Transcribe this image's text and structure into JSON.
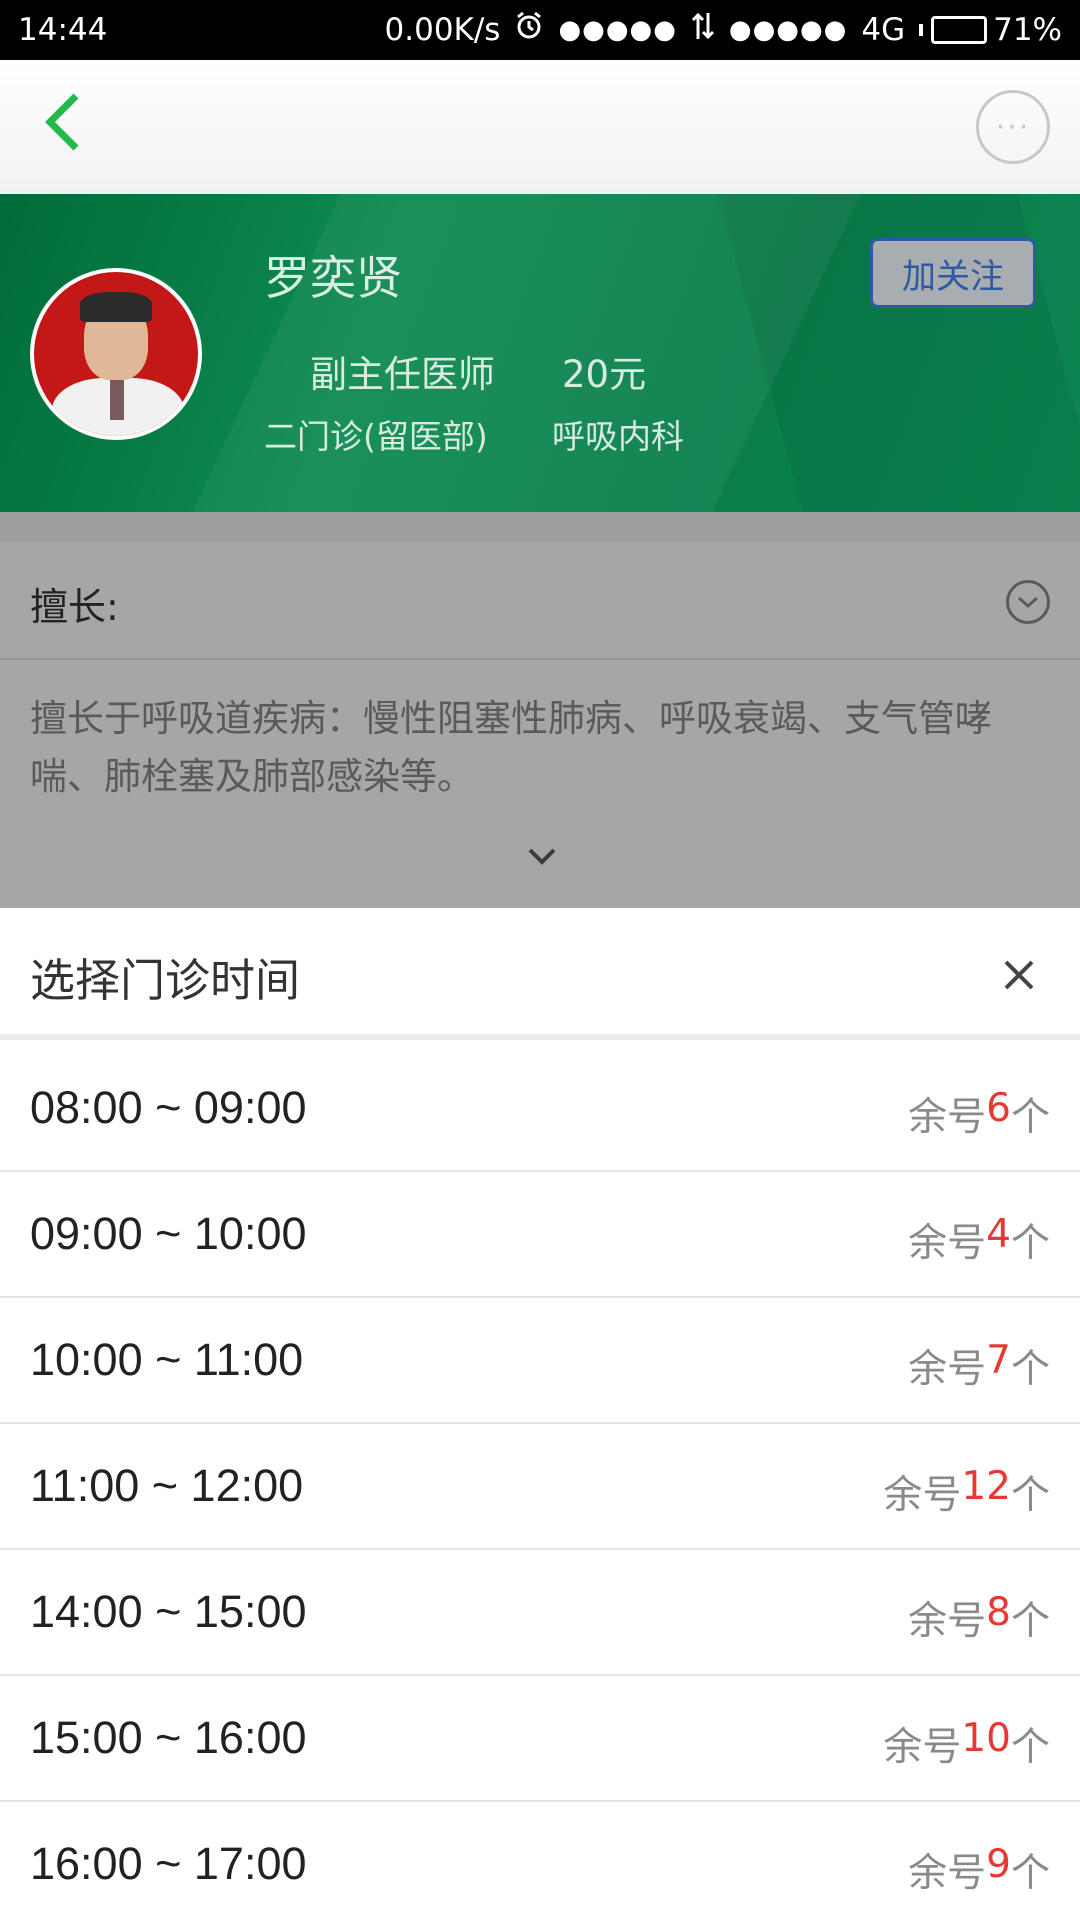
{
  "status_bar": {
    "time": "14:44",
    "speed": "0.00K/s",
    "signal_dots_1": "●●●●●",
    "signal_dots_2": "●●●●●",
    "network": "4G",
    "battery": "71%",
    "battery_level": 0.71
  },
  "nav": {
    "back_icon": "chevron-left-icon",
    "more_icon": "more-dots-icon",
    "more_label": "···",
    "accent_color": "#22b84a"
  },
  "doctor": {
    "name": "罗奕贤",
    "title": "副主任医师",
    "fee": "20元",
    "clinic": "二门诊(留医部)",
    "department": "呼吸内科",
    "follow_label": "加关注"
  },
  "specialty": {
    "label": "擅长:",
    "text": "擅长于呼吸道疾病：慢性阻塞性肺病、呼吸衰竭、支气管哮喘、肺栓塞及肺部感染等。"
  },
  "schedule": {
    "title": "选择门诊时间",
    "remain_prefix": "余号",
    "remain_suffix": "个",
    "slots": [
      {
        "time": "08:00 ~ 09:00",
        "count": "6"
      },
      {
        "time": "09:00 ~ 10:00",
        "count": "4"
      },
      {
        "time": "10:00 ~ 11:00",
        "count": "7"
      },
      {
        "time": "11:00 ~ 12:00",
        "count": "12"
      },
      {
        "time": "14:00 ~ 15:00",
        "count": "8"
      },
      {
        "time": "15:00 ~ 16:00",
        "count": "10"
      },
      {
        "time": "16:00 ~ 17:00",
        "count": "9"
      }
    ]
  }
}
